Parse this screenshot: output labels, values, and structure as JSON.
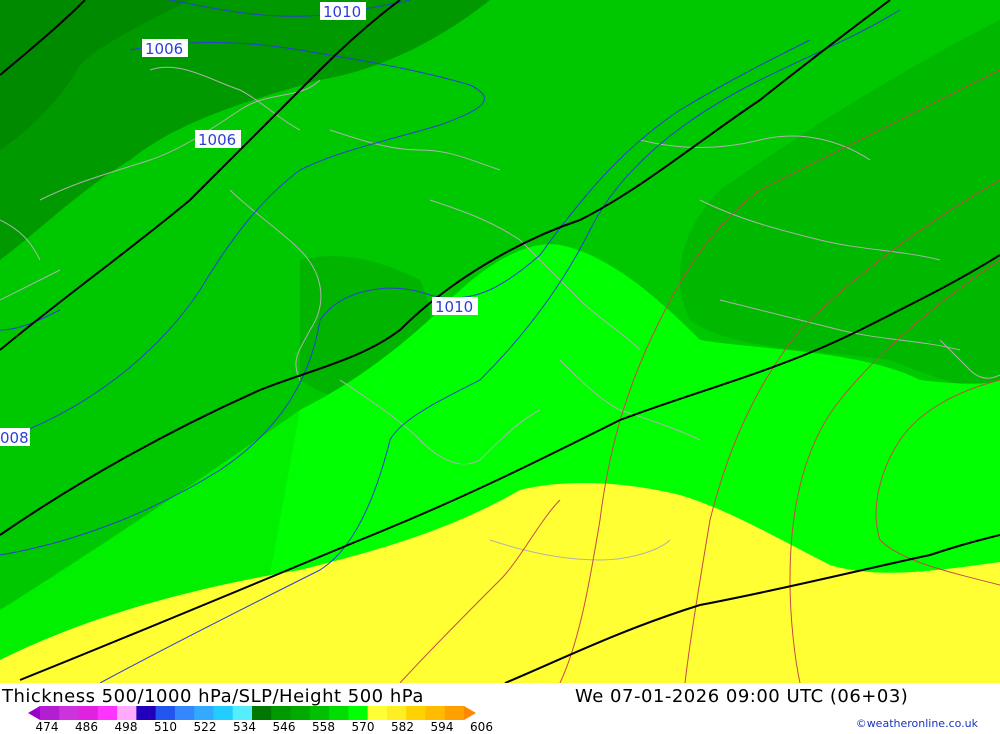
{
  "map": {
    "isobar_labels": [
      "1010",
      "1006",
      "1006",
      "1010",
      "008"
    ],
    "colors": {
      "dark_green": "#009900",
      "mid_green": "#00c800",
      "bright_green": "#00ff00",
      "green": "#00e000",
      "yellow": "#ffff33",
      "isobar": "#2a3fd6",
      "height_contour": "#000000",
      "thickness_contour": "#c84040",
      "coastline": "#aaaaaa"
    }
  },
  "footer": {
    "title": "Thickness 500/1000 hPa/SLP/Height 500 hPa",
    "datetime": "We 07-01-2026 09:00 UTC (06+03)",
    "credit": "©weatheronline.co.uk",
    "legend_ticks": [
      "474",
      "486",
      "498",
      "510",
      "522",
      "534",
      "546",
      "558",
      "570",
      "582",
      "594",
      "606"
    ],
    "legend_colors": [
      "#9900cc",
      "#b41ed2",
      "#cc33dd",
      "#e022e0",
      "#ff33ff",
      "#ffaaff",
      "#2200bb",
      "#2255ee",
      "#3388ff",
      "#33aaff",
      "#22ccff",
      "#55eeff",
      "#007700",
      "#009900",
      "#00aa00",
      "#00c000",
      "#00dd00",
      "#00ff00",
      "#ffff33",
      "#ffee22",
      "#ffd200",
      "#ffbb00",
      "#ffa000",
      "#ff8800"
    ]
  }
}
